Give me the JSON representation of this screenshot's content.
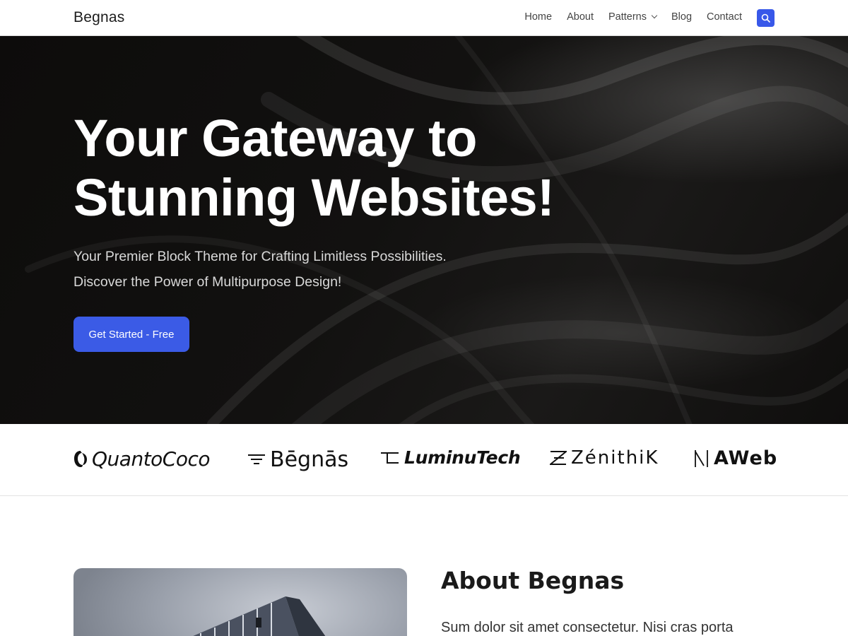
{
  "header": {
    "site_title": "Begnas",
    "nav": [
      {
        "label": "Home"
      },
      {
        "label": "About"
      },
      {
        "label": "Patterns"
      },
      {
        "label": "Blog"
      },
      {
        "label": "Contact"
      }
    ],
    "search_icon": "search-icon",
    "accent_color": "#3858e9"
  },
  "hero": {
    "title_line1": "Your Gateway to",
    "title_line2": "Stunning Websites!",
    "subtitle_line1": "Your Premier Block Theme for Crafting Limitless Possibilities.",
    "subtitle_line2": "Discover the Power of Multipurpose Design!",
    "cta_label": "Get Started - Free",
    "cta_color": "#3b5be6"
  },
  "logos": [
    {
      "name": "QuantoCoco"
    },
    {
      "name": "Bēgnās"
    },
    {
      "name": "LuminuTech"
    },
    {
      "name": "ZénithiK"
    },
    {
      "name": "AWeb"
    }
  ],
  "about": {
    "title": "About Begnas",
    "text": "Sum dolor sit amet consectetur. Nisi cras porta"
  }
}
